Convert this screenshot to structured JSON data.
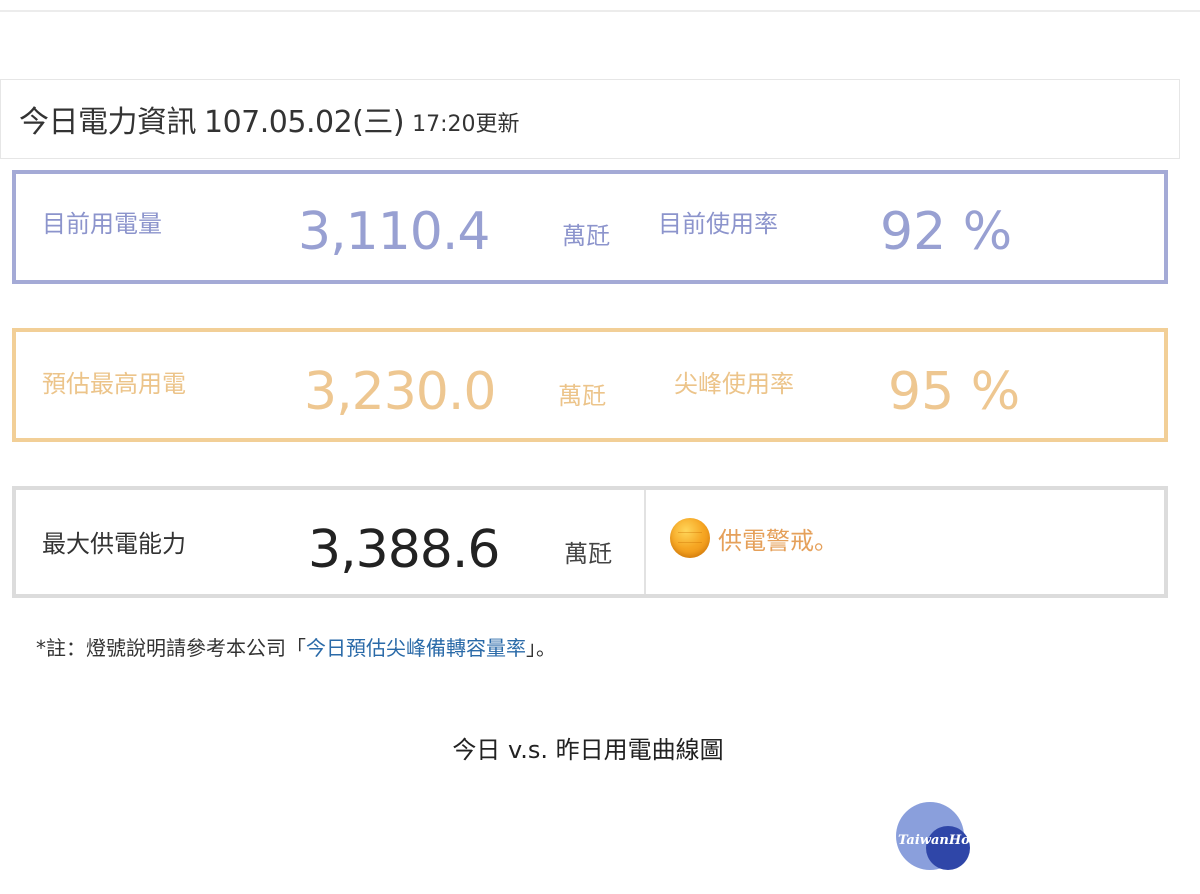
{
  "header": {
    "title": "今日電力資訊",
    "date": "107.05.02(三)",
    "updated": "17:20更新"
  },
  "current": {
    "label": "目前用電量",
    "value": "3,110.4",
    "unit": "萬瓩",
    "rate_label": "目前使用率",
    "rate_value": "92 %"
  },
  "peak": {
    "label": "預估最高用電",
    "value": "3,230.0",
    "unit": "萬瓩",
    "rate_label": "尖峰使用率",
    "rate_value": "95 %"
  },
  "supply": {
    "label": "最大供電能力",
    "value": "3,388.6",
    "unit": "萬瓩",
    "status_text": "供電警戒。",
    "lamp_color": "#f6a623"
  },
  "note": {
    "prefix": "*註：燈號說明請參考本公司「",
    "link": "今日預估尖峰備轉容量率",
    "suffix": "」。"
  },
  "chart_title": "今日 v.s. 昨日用電曲線圖",
  "watermark": {
    "text": "TaiwanHot"
  },
  "colors": {
    "current_border": "#a4aad6",
    "peak_border": "#f2cf97",
    "supply_border": "#dcdcdc",
    "link": "#2a6aa8"
  }
}
